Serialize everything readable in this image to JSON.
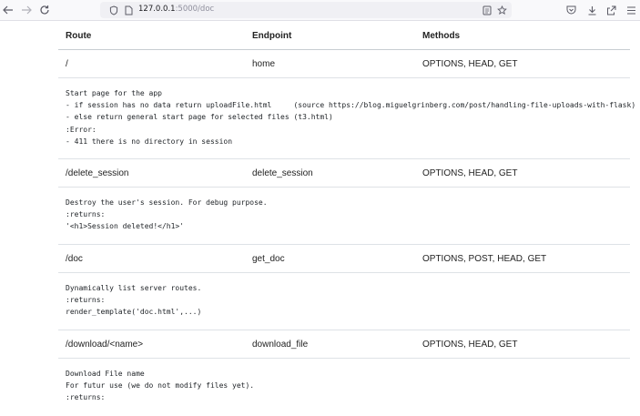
{
  "browser": {
    "url_host": "127.0.0.1",
    "url_path": ":5000/doc",
    "icons": {
      "back": "arrow-left-icon",
      "forward": "arrow-right-icon",
      "reload": "reload-icon",
      "tracking": "shield-icon",
      "page_info": "page-icon",
      "reader": "reader-view-icon",
      "bookmark": "star-icon",
      "pocket": "pocket-icon",
      "downloads": "download-icon",
      "share": "share-icon",
      "menu": "hamburger-menu-icon"
    }
  },
  "table": {
    "headers": {
      "route": "Route",
      "endpoint": "Endpoint",
      "methods": "Methods"
    },
    "routes": [
      {
        "route": "/",
        "endpoint": "home",
        "methods": "OPTIONS, HEAD, GET",
        "doc": [
          "Start page for the app",
          "- if session has no data return uploadFile.html     (source https://blog.miguelgrinberg.com/post/handling-file-uploads-with-flask)",
          "- else return general start page for selected files (t3.html)",
          ":Error:",
          "- 411 there is no directory in session"
        ]
      },
      {
        "route": "/delete_session",
        "endpoint": "delete_session",
        "methods": "OPTIONS, HEAD, GET",
        "doc": [
          "Destroy the user's session. For debug purpose.",
          ":returns:",
          "'<h1>Session deleted!</h1>'"
        ]
      },
      {
        "route": "/doc",
        "endpoint": "get_doc",
        "methods": "OPTIONS, POST, HEAD, GET",
        "doc": [
          "Dynamically list server routes.",
          ":returns:",
          "render_template('doc.html',...)"
        ]
      },
      {
        "route": "/download/<name>",
        "endpoint": "download_file",
        "methods": "OPTIONS, HEAD, GET",
        "doc": [
          "Download File name",
          "For futur use (we do not modify files yet).",
          ":returns:"
        ]
      }
    ]
  }
}
